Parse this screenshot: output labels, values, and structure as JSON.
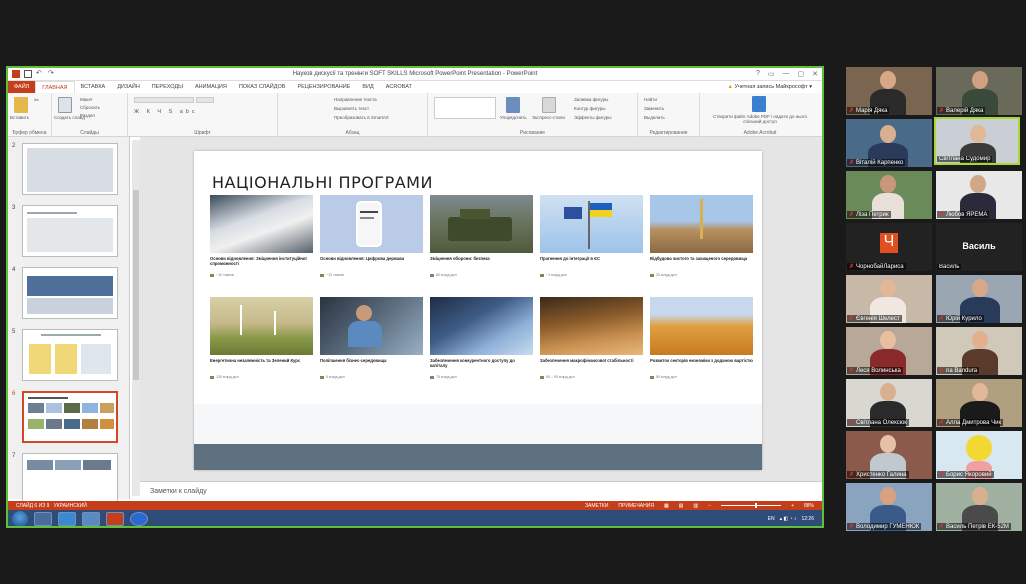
{
  "powerpoint": {
    "window_title": "Науков дискусії та тренінги SOFT SKILLS Microsoft PowerPoint Presentation - PowerPoint",
    "window_controls": [
      "?",
      "▭",
      "—",
      "▢",
      "✕"
    ],
    "tabs": [
      "ФАЙЛ",
      "ГЛАВНАЯ",
      "ВСТАВКА",
      "ДИЗАЙН",
      "ПЕРЕХОДЫ",
      "АНИМАЦИЯ",
      "ПОКАЗ СЛАЙДОВ",
      "РЕЦЕНЗИРОВАНИЕ",
      "ВИД",
      "ACROBAT"
    ],
    "account": "Учетная запись Майкрософт",
    "ribbon": {
      "paste": "Вставить",
      "new_slide": "Создать слайд",
      "layout": "Макет",
      "reset": "Сбросить",
      "section": "Раздел",
      "text_direction": "Направление текста",
      "align_text": "Выровнять текст",
      "smartart": "Преобразовать в SmartArt",
      "arrange": "Упорядочить",
      "quick_styles": "Экспресс-стили",
      "shape_fill": "Заливка фигуры",
      "shape_outline": "Контур фигуры",
      "shape_effects": "Эффекты фигуры",
      "find": "Найти",
      "replace": "Заменить",
      "select": "Выделить",
      "acrobat_action": "Створити файл Adobe PDF і надати до нього спільний доступ",
      "groups": [
        "Буфер обмена",
        "Слайды",
        "Шрифт",
        "Абзац",
        "Рисование",
        "Редактирование",
        "Adobe Acrobat"
      ]
    },
    "thumbnails": [
      {
        "num": "2",
        "selected": false
      },
      {
        "num": "3",
        "selected": false
      },
      {
        "num": "4",
        "selected": false
      },
      {
        "num": "5",
        "selected": false
      },
      {
        "num": "6",
        "selected": true
      },
      {
        "num": "7",
        "selected": false
      }
    ],
    "slide": {
      "title": "НАЦІОНАЛЬНІ ПРОГРАМИ",
      "cards": [
        {
          "caption": "Основи відновлення: Зміцнення інституційної спроможності",
          "meta": "~10 тижнів",
          "image": "meeting-photo"
        },
        {
          "caption": "Основи відновлення: Цифрова держава",
          "meta": "~10 тижнів",
          "image": "phone-photo"
        },
        {
          "caption": "Зміцнення оборони: безпека",
          "meta": "80 млрд дол",
          "image": "armored-vehicle-photo"
        },
        {
          "caption": "Прагнення до інтеграції в ЄС",
          "meta": "~1 млрд дол",
          "image": "flags-photo"
        },
        {
          "caption": "Відбудова чистого та захищеного середовища",
          "meta": "20 млрд дол",
          "image": "city-photo"
        },
        {
          "caption": "Енергетична незалежність та Зелений Курс",
          "meta": "130 млрд дол",
          "image": "wind-turbines-photo"
        },
        {
          "caption": "Поліпшення бізнес-середовища",
          "meta": "5 млрд дол",
          "image": "office-worker-photo"
        },
        {
          "caption": "Забезпечення конкурентного доступу до капіталу",
          "meta": "75 млрд дол",
          "image": "skyscrapers-photo"
        },
        {
          "caption": "Забезпечення макрофінансової стабільності",
          "meta": "90 – 95 млрд дол",
          "image": "gold-bars-photo"
        },
        {
          "caption": "Розвиток секторів економіки з доданою вартістю",
          "meta": "50 млрд дол",
          "image": "pipes-photo"
        }
      ]
    },
    "notes_placeholder": "Заметки к слайду",
    "status": {
      "slide_info": "СЛАЙД 6 ИЗ 9",
      "language": "УКРАИНСКИЙ",
      "notes_btn": "ЗАМЕТКИ",
      "comments_btn": "ПРИМЕЧАНИЯ",
      "zoom": "88%"
    },
    "taskbar": {
      "lang": "EN",
      "time": "12:26"
    }
  },
  "participants": [
    {
      "name": "Марія Дяка",
      "muted": true,
      "avatar": "photo",
      "active": false
    },
    {
      "name": "Валерій Дяка",
      "muted": true,
      "avatar": "photo",
      "active": false
    },
    {
      "name": "Віталій Карпенко",
      "muted": true,
      "avatar": "photo",
      "active": false
    },
    {
      "name": "Світлана Судомир",
      "muted": false,
      "avatar": "photo",
      "active": true
    },
    {
      "name": "Ліза Петрик",
      "muted": true,
      "avatar": "photo",
      "active": false
    },
    {
      "name": "Любов ЯРЕМА",
      "muted": true,
      "avatar": "photo",
      "active": false
    },
    {
      "name": "ЧорнобайЛариса",
      "muted": true,
      "avatar": "letter",
      "letter": "Ч",
      "active": false
    },
    {
      "name": "Василь",
      "muted": false,
      "avatar": "name",
      "center": "Василь",
      "active": false
    },
    {
      "name": "Євгенія Шелест",
      "muted": true,
      "avatar": "photo",
      "active": false
    },
    {
      "name": "Юрій Курило",
      "muted": true,
      "avatar": "photo",
      "active": false
    },
    {
      "name": "Леся Волинська",
      "muted": true,
      "avatar": "photo",
      "active": false
    },
    {
      "name": "na Bandura",
      "muted": true,
      "avatar": "photo",
      "active": false
    },
    {
      "name": "Світлана Олексюк",
      "muted": true,
      "avatar": "photo",
      "active": false
    },
    {
      "name": "Алла Дмитрова Чик",
      "muted": true,
      "avatar": "photo",
      "active": false
    },
    {
      "name": "Христенко Галина",
      "muted": true,
      "avatar": "photo",
      "active": false
    },
    {
      "name": "Борис Якоровий",
      "muted": true,
      "avatar": "photo",
      "active": false
    },
    {
      "name": "Володимир ГУМЕНЮК",
      "muted": true,
      "avatar": "photo",
      "active": false
    },
    {
      "name": "Василь Петрів ЕК-52М",
      "muted": true,
      "avatar": "photo",
      "active": false
    }
  ]
}
